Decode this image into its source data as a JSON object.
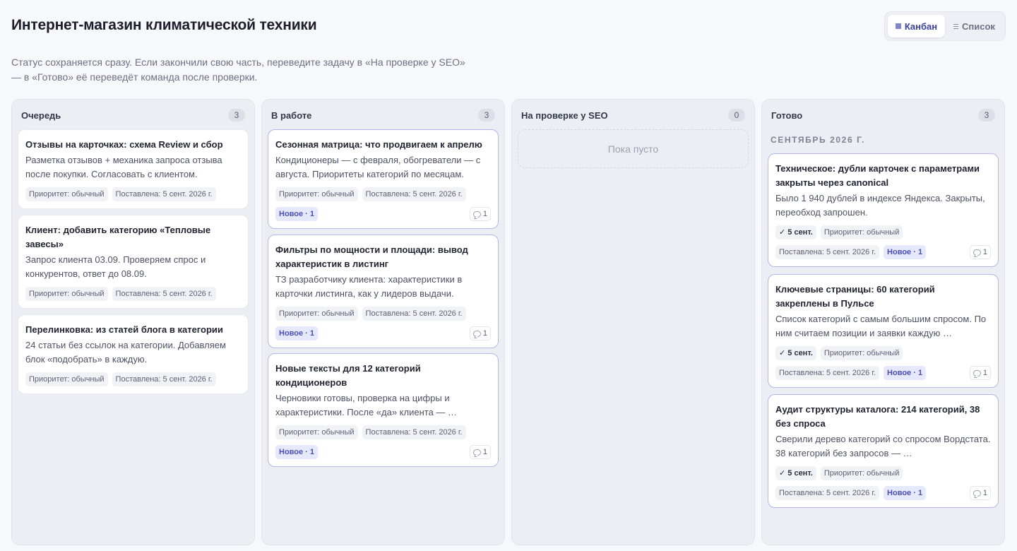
{
  "page": {
    "title": "Интернет-магазин климатической техники",
    "hint": "Статус сохраняется сразу. Если закончили свою часть, переведите задачу в «На проверке у SEO» — в «Готово» её переведёт команда после проверки."
  },
  "view_toggle": {
    "kanban": "Канбан",
    "list": "Список",
    "active": "kanban"
  },
  "columns": [
    {
      "title": "Очередь",
      "count": "3",
      "cards": [
        {
          "title": "Отзывы на карточках: схема Review и сбор",
          "desc": "Разметка отзывов + механика запроса отзыва после покупки. Согласовать с клиентом.",
          "priority": "Приоритет: обычный",
          "posted": "Поставлена: 5 сент. 2026 г."
        },
        {
          "title": "Клиент: добавить категорию «Тепловые завесы»",
          "desc": "Запрос клиента 03.09. Проверяем спрос и конкурентов, ответ до 08.09.",
          "priority": "Приоритет: обычный",
          "posted": "Поставлена: 5 сент. 2026 г."
        },
        {
          "title": "Перелинковка: из статей блога в категории",
          "desc": "24 статьи без ссылок на категории. Добавляем блок «подобрать» в каждую.",
          "priority": "Приоритет: обычный",
          "posted": "Поставлена: 5 сент. 2026 г."
        }
      ]
    },
    {
      "title": "В работе",
      "count": "3",
      "cards": [
        {
          "title": "Сезонная матрица: что продвигаем к апрелю",
          "desc": "Кондиционеры — с февраля, обогреватели — с августа. Приоритеты категорий по месяцам.",
          "priority": "Приоритет: обычный",
          "posted": "Поставлена: 5 сент. 2026 г.",
          "new": "Новое · 1",
          "comments": "1"
        },
        {
          "title": "Фильтры по мощности и площади: вывод характеристик в листинг",
          "desc": "ТЗ разработчику клиента: характеристики в карточки листинга, как у лидеров выдачи.",
          "priority": "Приоритет: обычный",
          "posted": "Поставлена: 5 сент. 2026 г.",
          "new": "Новое · 1",
          "comments": "1"
        },
        {
          "title": "Новые тексты для 12 категорий кондиционеров",
          "desc": "Черновики готовы, проверка на цифры и характеристики. После «да» клиента — …",
          "priority": "Приоритет: обычный",
          "posted": "Поставлена: 5 сент. 2026 г.",
          "new": "Новое · 1",
          "comments": "1"
        }
      ]
    },
    {
      "title": "На проверке у SEO",
      "count": "0",
      "empty": "Пока пусто"
    },
    {
      "title": "Готово",
      "count": "3",
      "group": "СЕНТЯБРЬ 2026 Г.",
      "cards": [
        {
          "title": "Техническое: дубли карточек с параметрами закрыты через canonical",
          "desc": "Было 1 940 дублей в индексе Яндекса. Закрыты, переобход запрошен.",
          "done": "✓ 5 сент.",
          "priority": "Приоритет: обычный",
          "posted": "Поставлена: 5 сент. 2026 г.",
          "new": "Новое · 1",
          "comments": "1"
        },
        {
          "title": "Ключевые страницы: 60 категорий закреплены в Пульсе",
          "desc": "Список категорий с самым большим спросом. По ним считаем позиции и заявки каждую …",
          "done": "✓ 5 сент.",
          "priority": "Приоритет: обычный",
          "posted": "Поставлена: 5 сент. 2026 г.",
          "new": "Новое · 1",
          "comments": "1"
        },
        {
          "title": "Аудит структуры каталога: 214 категорий, 38 без спроса",
          "desc": "Сверили дерево категорий со спросом Вордстата. 38 категорий без запросов — …",
          "done": "✓ 5 сент.",
          "priority": "Приоритет: обычный",
          "posted": "Поставлена: 5 сент. 2026 г.",
          "new": "Новое · 1",
          "comments": "1"
        }
      ]
    }
  ]
}
